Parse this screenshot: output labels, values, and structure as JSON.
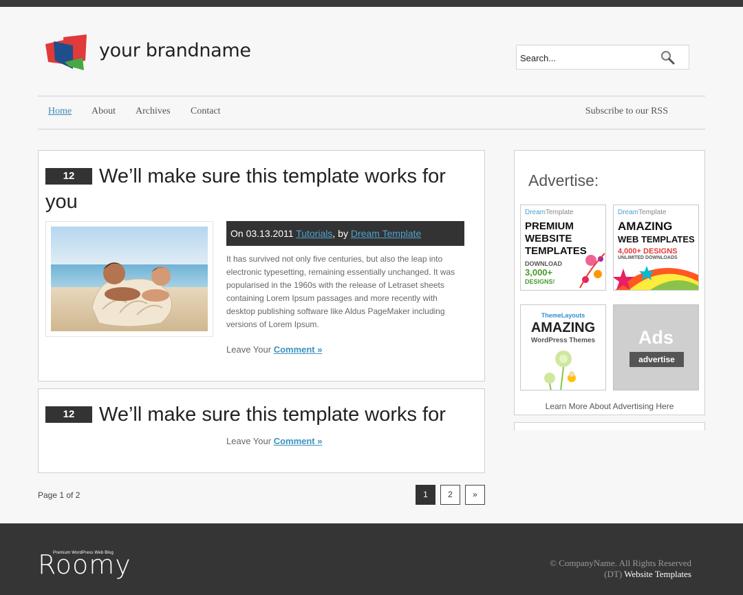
{
  "header": {
    "brand": "your brandname",
    "search_placeholder": "Search..."
  },
  "nav": {
    "items": [
      "Home",
      "About",
      "Archives",
      "Contact"
    ],
    "active": "Home",
    "rss": "Subscribe to our RSS"
  },
  "posts": [
    {
      "date": "12",
      "title": "We’ll make sure this template works for you",
      "meta_prefix": "On 03.13.2011 ",
      "category": "Tutorials",
      "by": ", by ",
      "author": "Dream Template",
      "excerpt": "It has survived not only five centuries, but also the leap into electronic typesetting, remaining essentially unchanged. It was popularised in the 1960s with the release of Letraset sheets containing Lorem Ipsum passages and more recently with desktop publishing software like Aldus PageMaker including versions of Lorem Ipsum.",
      "comment_prefix": "Leave Your ",
      "comment_link": "Comment »"
    },
    {
      "date": "12",
      "title": "We’ll make sure this template works for",
      "comment_prefix": "Leave Your ",
      "comment_link": "Comment »"
    }
  ],
  "pagination": {
    "info": "Page 1 of 2",
    "pages": [
      "1",
      "2",
      "»"
    ],
    "current": "1"
  },
  "sidebar": {
    "title": "Advertise:",
    "ads": [
      {
        "brand_a": "Dream",
        "brand_b": "Template",
        "line1": "PREMIUM",
        "line2": "WEBSITE",
        "line3": "TEMPLATES",
        "sub1": "DOWNLOAD",
        "sub2": "3,000+",
        "sub3": "DESIGNS!"
      },
      {
        "brand_a": "Dream",
        "brand_b": "Template",
        "line1": "AMAZING",
        "line2": "WEB TEMPLATES",
        "line3": "4,000+ DESIGNS",
        "sub1": "UNLIMITED DOWNLOADS"
      },
      {
        "brand": "ThemeLayouts",
        "line1": "AMAZING",
        "line2": "WordPress Themes"
      },
      {
        "line1": "Ads",
        "button": "advertise"
      }
    ],
    "learn_more": "Learn More About Advertising Here"
  },
  "footer": {
    "logo": "Roomy",
    "tagline": "Premium WordPress Web Blog",
    "copyright": "© CompanyName. All Rights Reserved",
    "dt_prefix": "(DT) ",
    "dt_link": "Website Templates"
  },
  "colors": {
    "accent": "#3a93c0",
    "dark": "#333333",
    "footer_bg": "#353535"
  }
}
